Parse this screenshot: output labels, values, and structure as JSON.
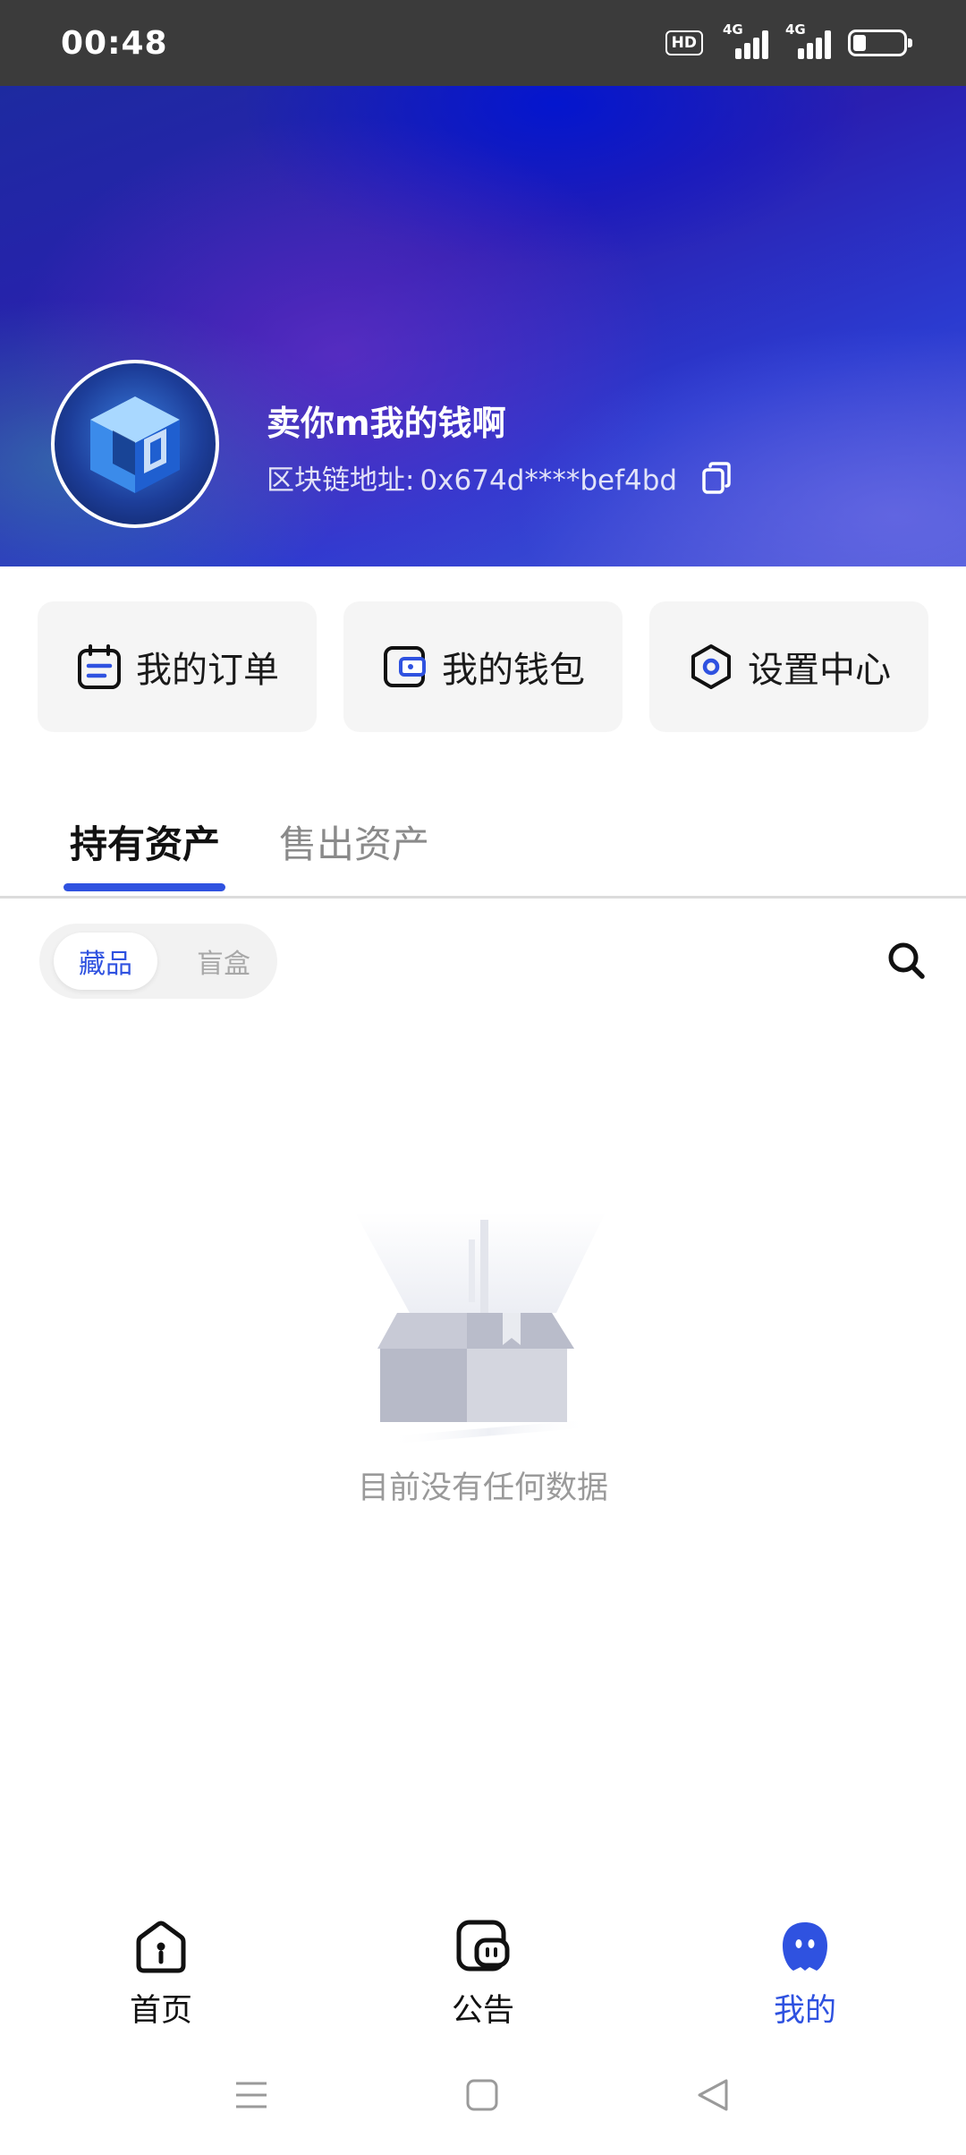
{
  "status_bar": {
    "time": "00:48",
    "hd_label": "HD",
    "network_1": "4G",
    "network_2": "4G"
  },
  "profile": {
    "nickname": "卖你m我的钱啊",
    "address_label": "区块链地址:",
    "address_value": "0x674d****bef4bd"
  },
  "quick_actions": [
    {
      "label": "我的订单",
      "icon": "calendar-icon"
    },
    {
      "label": "我的钱包",
      "icon": "wallet-icon"
    },
    {
      "label": "设置中心",
      "icon": "hexagon-settings-icon"
    }
  ],
  "tabs": {
    "active": "持有资产",
    "inactive": "售出资产"
  },
  "filter": {
    "selected": "藏品",
    "other": "盲盒"
  },
  "empty_state": {
    "text": "目前没有任何数据"
  },
  "bottom_nav": [
    {
      "label": "首页",
      "icon": "home-icon"
    },
    {
      "label": "公告",
      "icon": "notice-icon"
    },
    {
      "label": "我的",
      "icon": "profile-icon",
      "active": true
    }
  ],
  "colors": {
    "accent": "#2f52e0",
    "card_bg": "#f5f5f5",
    "status_bar_bg": "#3b3b3b",
    "muted_text": "#9a9a9a"
  }
}
